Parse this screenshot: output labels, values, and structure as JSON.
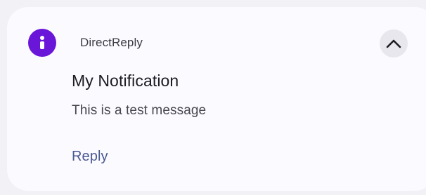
{
  "notification": {
    "app_name": "DirectReply",
    "app_icon": "info-icon",
    "title": "My Notification",
    "message": "This is a test message",
    "actions": [
      {
        "label": "Reply"
      }
    ],
    "expand_icon": "chevron-up-icon"
  },
  "colors": {
    "background": "#f2f1f6",
    "card": "#fbfafe",
    "app_icon_bg": "#6a16d9",
    "action_text": "#4a5892",
    "expand_button_bg": "#e9e7ee"
  }
}
